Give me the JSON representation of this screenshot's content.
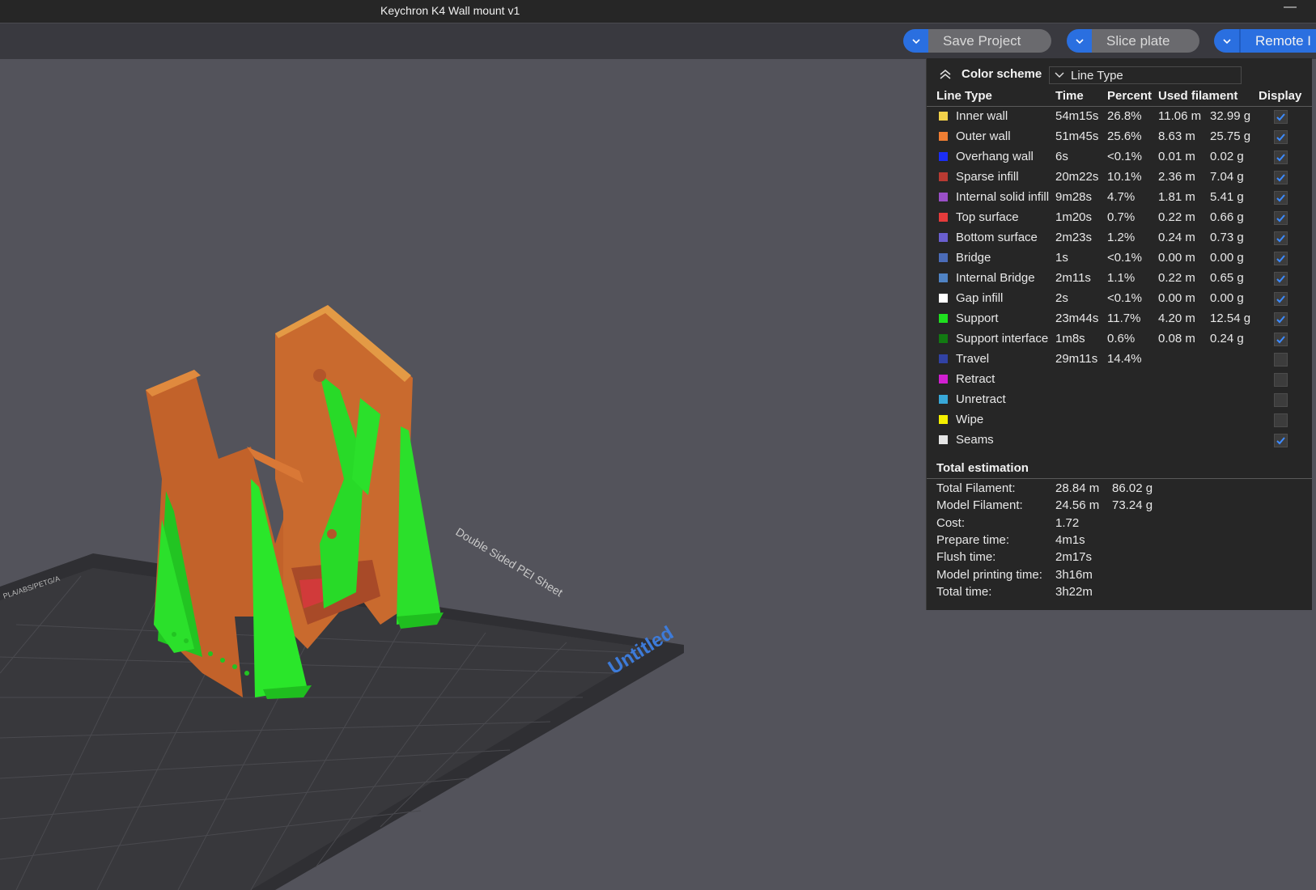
{
  "window": {
    "title": "Keychron K4 Wall mount v1",
    "minimize_glyph": "—"
  },
  "toolbar": {
    "save_project": "Save Project",
    "slice_plate": "Slice plate",
    "remote": "Remote I"
  },
  "plate": {
    "sheet_label": "Double Sided PEI Sheet",
    "plate_name": "Untitled",
    "filament_label": "PLA/ABS/PETG/A"
  },
  "legend": {
    "color_scheme_label": "Color scheme",
    "color_scheme_value": "Line Type",
    "headers": {
      "line_type": "Line Type",
      "time": "Time",
      "percent": "Percent",
      "used_filament": "Used filament",
      "display": "Display"
    },
    "rows": [
      {
        "name": "Inner wall",
        "time": "54m15s",
        "percent": "26.8%",
        "m": "11.06 m",
        "g": "32.99 g",
        "color": "#f2d14a",
        "checked": true
      },
      {
        "name": "Outer wall",
        "time": "51m45s",
        "percent": "25.6%",
        "m": "8.63 m",
        "g": "25.75 g",
        "color": "#ef7e33",
        "checked": true
      },
      {
        "name": "Overhang wall",
        "time": "6s",
        "percent": "<0.1%",
        "m": "0.01 m",
        "g": "0.02 g",
        "color": "#1b2ef5",
        "checked": true
      },
      {
        "name": "Sparse infill",
        "time": "20m22s",
        "percent": "10.1%",
        "m": "2.36 m",
        "g": "7.04 g",
        "color": "#b93a32",
        "checked": true
      },
      {
        "name": "Internal solid infill",
        "time": "9m28s",
        "percent": "4.7%",
        "m": "1.81 m",
        "g": "5.41 g",
        "color": "#9a4fc8",
        "checked": true
      },
      {
        "name": "Top surface",
        "time": "1m20s",
        "percent": "0.7%",
        "m": "0.22 m",
        "g": "0.66 g",
        "color": "#e53b3b",
        "checked": true
      },
      {
        "name": "Bottom surface",
        "time": "2m23s",
        "percent": "1.2%",
        "m": "0.24 m",
        "g": "0.73 g",
        "color": "#6a5fcf",
        "checked": true
      },
      {
        "name": "Bridge",
        "time": "1s",
        "percent": "<0.1%",
        "m": "0.00 m",
        "g": "0.00 g",
        "color": "#4b6cb8",
        "checked": true
      },
      {
        "name": "Internal Bridge",
        "time": "2m11s",
        "percent": "1.1%",
        "m": "0.22 m",
        "g": "0.65 g",
        "color": "#5083c4",
        "checked": true
      },
      {
        "name": "Gap infill",
        "time": "2s",
        "percent": "<0.1%",
        "m": "0.00 m",
        "g": "0.00 g",
        "color": "#ffffff",
        "checked": true
      },
      {
        "name": "Support",
        "time": "23m44s",
        "percent": "11.7%",
        "m": "4.20 m",
        "g": "12.54 g",
        "color": "#1fe01f",
        "checked": true
      },
      {
        "name": "Support interface",
        "time": "1m8s",
        "percent": "0.6%",
        "m": "0.08 m",
        "g": "0.24 g",
        "color": "#127a12",
        "checked": true
      },
      {
        "name": "Travel",
        "time": "29m11s",
        "percent": "14.4%",
        "m": "",
        "g": "",
        "color": "#3142a4",
        "checked": false
      },
      {
        "name": "Retract",
        "time": "",
        "percent": "",
        "m": "",
        "g": "",
        "color": "#d11fd1",
        "checked": false
      },
      {
        "name": "Unretract",
        "time": "",
        "percent": "",
        "m": "",
        "g": "",
        "color": "#38a8d8",
        "checked": false
      },
      {
        "name": "Wipe",
        "time": "",
        "percent": "",
        "m": "",
        "g": "",
        "color": "#f5f000",
        "checked": false
      },
      {
        "name": "Seams",
        "time": "",
        "percent": "",
        "m": "",
        "g": "",
        "color": "#e6e6e6",
        "checked": true
      }
    ]
  },
  "totals": {
    "title": "Total estimation",
    "items": [
      {
        "label": "Total Filament:",
        "v1": "28.84 m",
        "v2": "86.02 g"
      },
      {
        "label": "Model Filament:",
        "v1": "24.56 m",
        "v2": "73.24 g"
      },
      {
        "label": "Cost:",
        "v1": "1.72",
        "v2": ""
      },
      {
        "label": "Prepare time:",
        "v1": "4m1s",
        "v2": ""
      },
      {
        "label": "Flush time:",
        "v1": "2m17s",
        "v2": ""
      },
      {
        "label": "Model printing time:",
        "v1": "3h16m",
        "v2": ""
      },
      {
        "label": "Total time:",
        "v1": "3h22m",
        "v2": ""
      }
    ]
  }
}
